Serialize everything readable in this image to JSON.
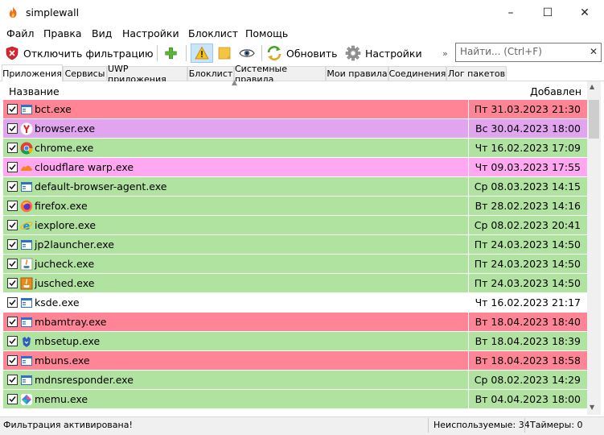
{
  "window": {
    "title": "simplewall",
    "minimize": "–",
    "maximize": "☐",
    "close": "✕"
  },
  "menu": [
    "Файл",
    "Правка",
    "Вид",
    "Настройки",
    "Блоклист",
    "Помощь"
  ],
  "toolbar": {
    "disable_filter": "Отключить фильтрацию",
    "refresh": "Обновить",
    "settings": "Настройки",
    "overflow": "»"
  },
  "search": {
    "placeholder": "Найти... (Ctrl+F)",
    "value": "",
    "clear": "✕"
  },
  "tabs": [
    "Приложения",
    "Сервисы",
    "UWP приложения",
    "Блоклист",
    "Системные правила",
    "Мои правила",
    "Соединения",
    "Лог пакетов"
  ],
  "columns": {
    "name": "Название",
    "added": "Добавлен"
  },
  "colors": {
    "red": "#ff8596",
    "purple": "#e1a5ef",
    "pink": "#ffa7f1",
    "green": "#b0e2a0",
    "white": "#ffffff"
  },
  "apps": [
    {
      "name": "bct.exe",
      "date": "Пт 31.03.2023 21:30",
      "color": "red",
      "icon": "window-icon"
    },
    {
      "name": "browser.exe",
      "date": "Вс 30.04.2023 18:00",
      "color": "purple",
      "icon": "yandex-icon"
    },
    {
      "name": "chrome.exe",
      "date": "Чт 16.02.2023 17:09",
      "color": "green",
      "icon": "chrome-icon"
    },
    {
      "name": "cloudflare warp.exe",
      "date": "Чт 09.03.2023 17:55",
      "color": "pink",
      "icon": "cloud-icon"
    },
    {
      "name": "default-browser-agent.exe",
      "date": "Ср 08.03.2023 14:15",
      "color": "green",
      "icon": "window-icon"
    },
    {
      "name": "firefox.exe",
      "date": "Вт 28.02.2023 14:16",
      "color": "green",
      "icon": "firefox-icon"
    },
    {
      "name": "iexplore.exe",
      "date": "Ср 08.02.2023 20:41",
      "color": "green",
      "icon": "ie-icon"
    },
    {
      "name": "jp2launcher.exe",
      "date": "Пт 24.03.2023 14:50",
      "color": "green",
      "icon": "window-icon"
    },
    {
      "name": "jucheck.exe",
      "date": "Пт 24.03.2023 14:50",
      "color": "green",
      "icon": "java-icon"
    },
    {
      "name": "jusched.exe",
      "date": "Пт 24.03.2023 14:50",
      "color": "green",
      "icon": "java-orange-icon"
    },
    {
      "name": "ksde.exe",
      "date": "Чт 16.02.2023 21:17",
      "color": "white",
      "icon": "window-icon"
    },
    {
      "name": "mbamtray.exe",
      "date": "Вт 18.04.2023 18:40",
      "color": "red",
      "icon": "window-icon"
    },
    {
      "name": "mbsetup.exe",
      "date": "Вт 18.04.2023 18:39",
      "color": "green",
      "icon": "malwarebytes-icon"
    },
    {
      "name": "mbuns.exe",
      "date": "Вт 18.04.2023 18:58",
      "color": "red",
      "icon": "window-icon"
    },
    {
      "name": "mdnsresponder.exe",
      "date": "Ср 08.02.2023 14:29",
      "color": "green",
      "icon": "window-icon"
    },
    {
      "name": "memu.exe",
      "date": "Вт 04.04.2023 18:00",
      "color": "green",
      "icon": "memu-icon"
    }
  ],
  "status": {
    "filter": "Фильтрация активирована!",
    "unused": "Неиспользуемые: 34",
    "timers": "Таймеры: 0"
  }
}
